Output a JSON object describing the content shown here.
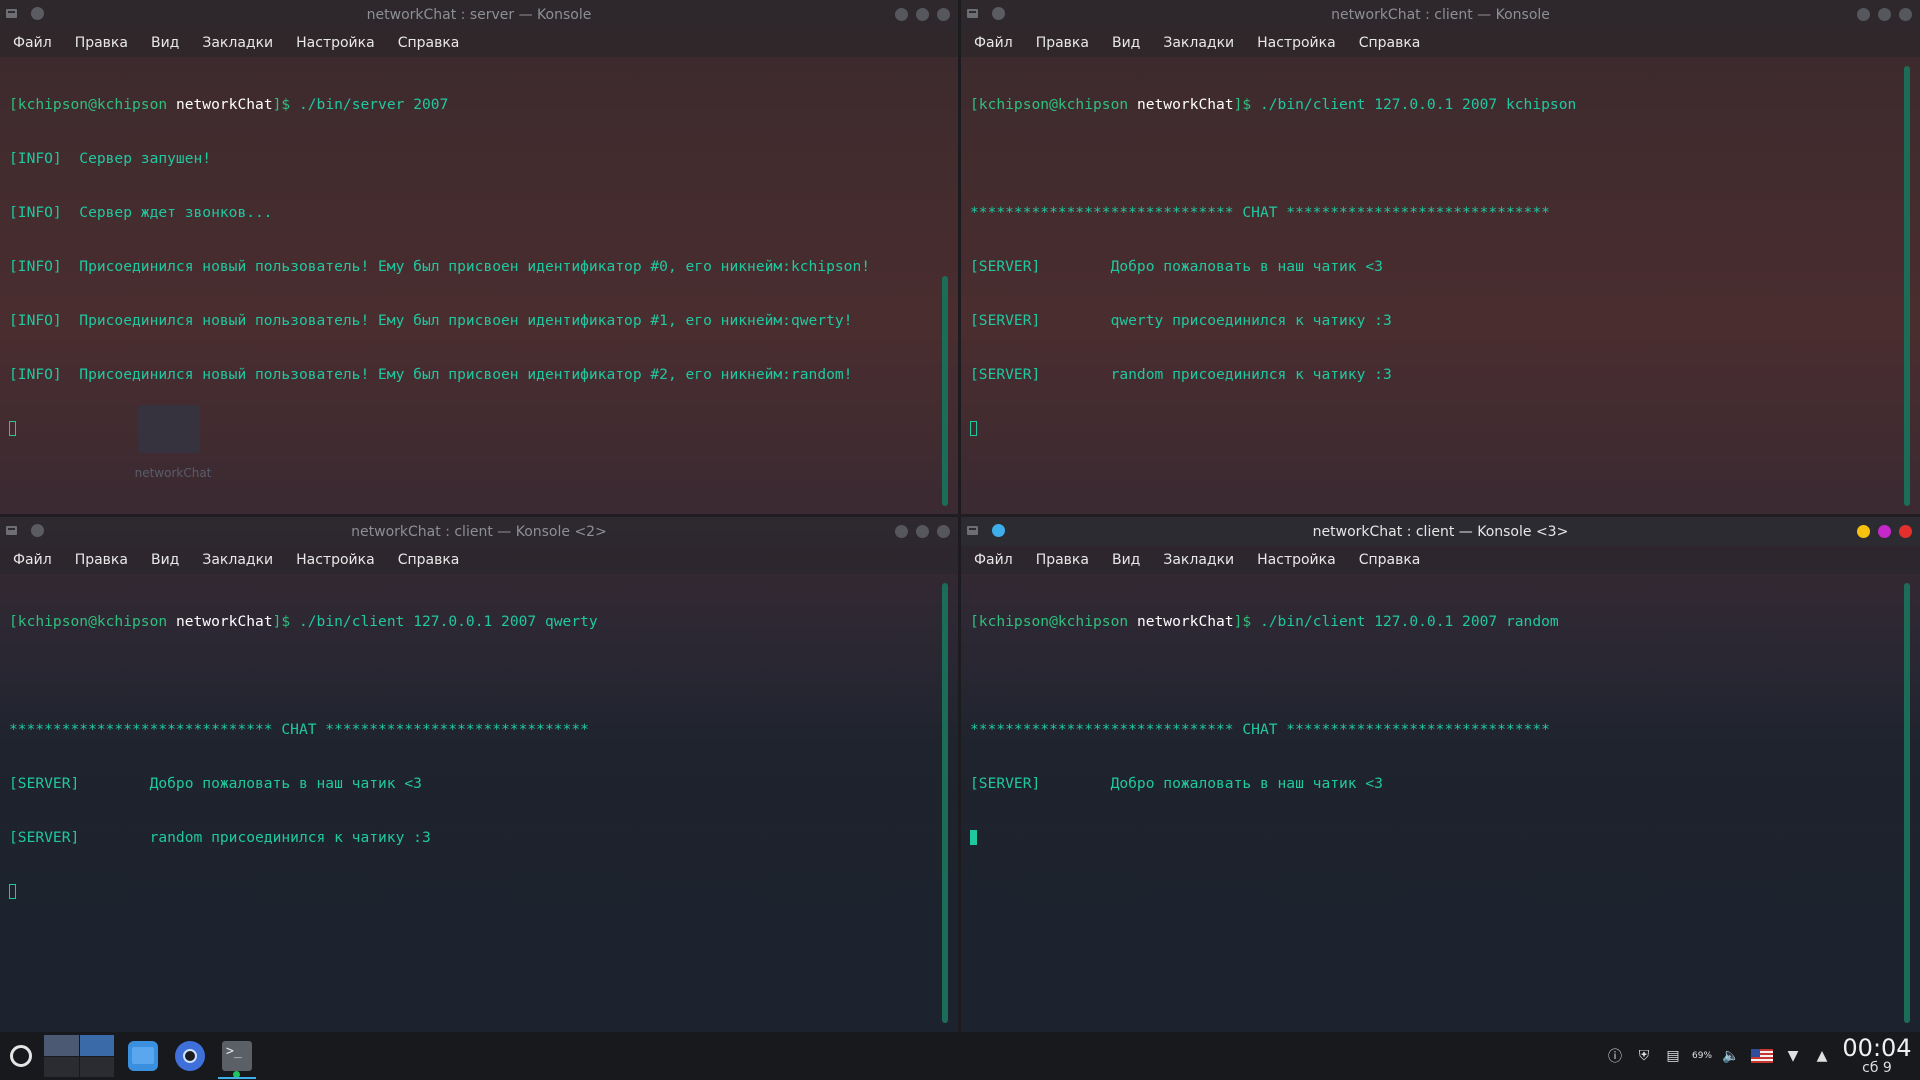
{
  "desktop": {
    "folder_label": "networkChat"
  },
  "windows": [
    {
      "id": "server",
      "title": "networkChat : server — Konsole",
      "menu": [
        "Файл",
        "Правка",
        "Вид",
        "Закладки",
        "Настройка",
        "Справка"
      ],
      "prompt_user": "[kchipson@kchipson",
      "prompt_host": "networkChat",
      "prompt_end": "]$",
      "command": " ./bin/server 2007",
      "lines": [
        "[INFO]  Сервер запушен!",
        "[INFO]  Сервер ждет звонков...",
        "[INFO]  Присоединился новый пользователь! Ему был присвоен идентификатор #0, его никнейм:kchipson!",
        "[INFO]  Присоединился новый пользователь! Ему был присвоен идентификатор #1, его никнейм:qwerty!",
        "[INFO]  Присоединился новый пользователь! Ему был присвоен идентификатор #2, его никнейм:random!"
      ]
    },
    {
      "id": "client1",
      "title": "networkChat : client — Konsole",
      "menu": [
        "Файл",
        "Правка",
        "Вид",
        "Закладки",
        "Настройка",
        "Справка"
      ],
      "prompt_user": "[kchipson@kchipson",
      "prompt_host": "networkChat",
      "prompt_end": "]$",
      "command": " ./bin/client 127.0.0.1 2007 kchipson",
      "lines": [
        "",
        "****************************** CHAT ******************************",
        "[SERVER]        Добро пожаловать в наш чатик <3",
        "[SERVER]        qwerty присоединился к чатику :3",
        "[SERVER]        random присоединился к чатику :3"
      ]
    },
    {
      "id": "client2",
      "title": "networkChat : client — Konsole <2>",
      "menu": [
        "Файл",
        "Правка",
        "Вид",
        "Закладки",
        "Настройка",
        "Справка"
      ],
      "prompt_user": "[kchipson@kchipson",
      "prompt_host": "networkChat",
      "prompt_end": "]$",
      "command": " ./bin/client 127.0.0.1 2007 qwerty",
      "lines": [
        "",
        "****************************** CHAT ******************************",
        "[SERVER]        Добро пожаловать в наш чатик <3",
        "[SERVER]        random присоединился к чатику :3"
      ]
    },
    {
      "id": "client3",
      "title": "networkChat : client — Konsole <3>",
      "menu": [
        "Файл",
        "Правка",
        "Вид",
        "Закладки",
        "Настройка",
        "Справка"
      ],
      "prompt_user": "[kchipson@kchipson",
      "prompt_host": "networkChat",
      "prompt_end": "]$",
      "command": " ./bin/client 127.0.0.1 2007 random",
      "lines": [
        "",
        "****************************** CHAT ******************************",
        "[SERVER]        Добро пожаловать в наш чатик <3"
      ]
    }
  ],
  "taskbar": {
    "apps": [
      "application-launcher-icon",
      "file-manager-icon",
      "browser-icon",
      "konsole-icon"
    ],
    "tray": {
      "battery_label": "69%",
      "keyboard_layout": "us"
    },
    "clock": {
      "time": "00:04",
      "date": "сб 9"
    }
  },
  "colors": {
    "terminal_text": "#20c8a0",
    "prompt_host": "#ffffff",
    "accent": "#3daee9",
    "close_active": "#e4302c",
    "max_active": "#c428ca",
    "min_active": "#f6c20d"
  }
}
